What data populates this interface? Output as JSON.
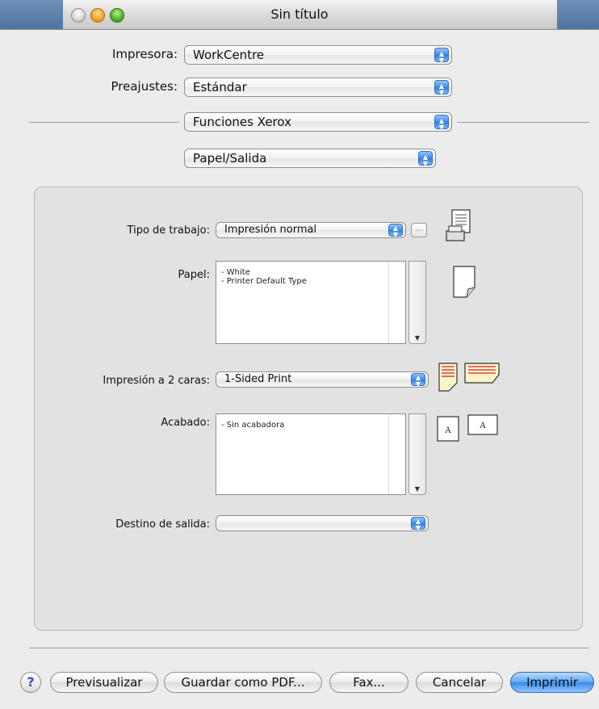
{
  "window": {
    "title": "Sin título"
  },
  "printer": {
    "label": "Impresora:",
    "value": "WorkCentre"
  },
  "presets": {
    "label": "Preajustes:",
    "value": "Estándar"
  },
  "features_menu": {
    "value": "Funciones Xerox"
  },
  "section_menu": {
    "value": "Papel/Salida"
  },
  "job_type": {
    "label": "Tipo de trabajo:",
    "value": "Impresión normal",
    "more_label": "..."
  },
  "paper": {
    "label": "Papel:",
    "items": [
      "- White",
      "- Printer Default Type"
    ]
  },
  "duplex": {
    "label": "Impresión a 2 caras:",
    "value": "1-Sided Print"
  },
  "finishing": {
    "label": "Acabado:",
    "items": [
      "- Sin acabadora"
    ]
  },
  "output_destination": {
    "label": "Destino de salida:",
    "value": ""
  },
  "buttons": {
    "help": "?",
    "preview": "Previsualizar",
    "save_pdf": "Guardar como PDF...",
    "fax": "Fax...",
    "cancel": "Cancelar",
    "print": "Imprimir"
  },
  "icons": {
    "job": "printer-document-icon",
    "paper": "paper-sheet-icon",
    "duplex": "duplex-pages-icon",
    "finishing": "finishing-letter-icon"
  },
  "colors": {
    "accent": "#3a8ae6",
    "titlebar_edge": "#5b7fae"
  }
}
